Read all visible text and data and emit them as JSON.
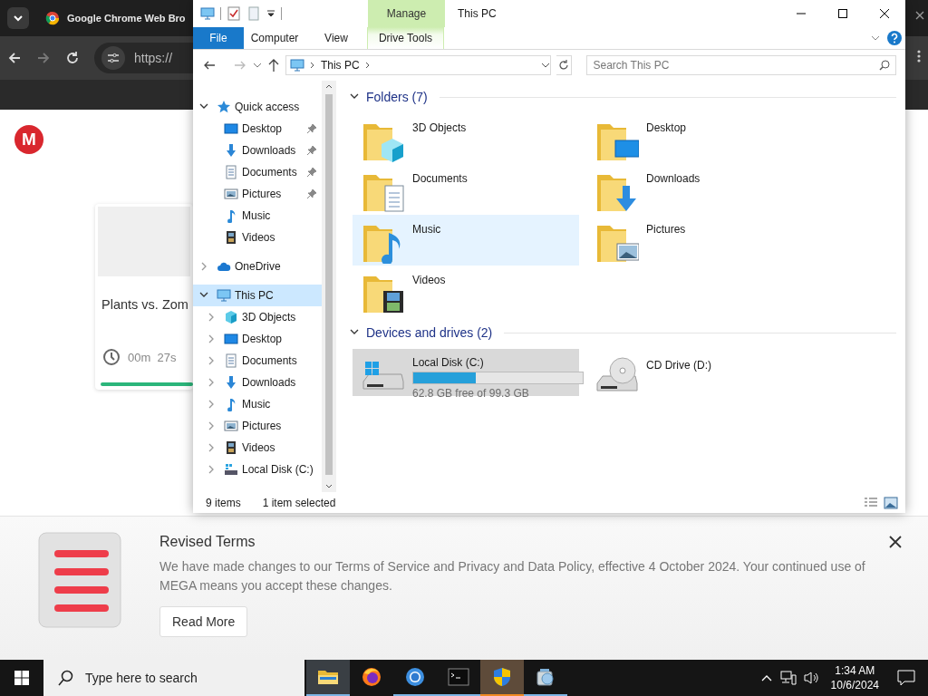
{
  "browser": {
    "tab_title": "Google Chrome Web Bro",
    "url": "https://"
  },
  "page": {
    "logo": "M",
    "card": {
      "title": "Plants vs. Zom",
      "timer": "00m  27s"
    }
  },
  "banner": {
    "title": "Revised Terms",
    "text": "We have made changes to our Terms of Service and Privacy and Data Policy, effective 4 October 2024. Your continued use of MEGA means you accept these changes.",
    "button": "Read More"
  },
  "explorer": {
    "context_tab": "Manage",
    "title": "This PC",
    "ribbon_tabs": [
      {
        "label": "File",
        "kind": "file"
      },
      {
        "label": "Computer",
        "kind": "tab"
      },
      {
        "label": "View",
        "kind": "tab"
      },
      {
        "label": "Drive Tools",
        "kind": "context"
      }
    ],
    "address": "This PC",
    "search": {
      "placeholder": "Search This PC"
    },
    "nav": [
      {
        "label": "Quick access",
        "kind": "star",
        "expanded": true,
        "selected": false,
        "children": [
          {
            "label": "Desktop",
            "kind": "desktop",
            "pinned": true,
            "selected": false
          },
          {
            "label": "Downloads",
            "kind": "downloads",
            "pinned": true,
            "selected": false
          },
          {
            "label": "Documents",
            "kind": "documents",
            "pinned": true,
            "selected": false
          },
          {
            "label": "Pictures",
            "kind": "pictures",
            "pinned": true,
            "selected": false
          },
          {
            "label": "Music",
            "kind": "music",
            "pinned": false,
            "selected": false
          },
          {
            "label": "Videos",
            "kind": "videos",
            "pinned": false,
            "selected": false
          }
        ]
      },
      {
        "label": "OneDrive",
        "kind": "cloud",
        "expanded": false,
        "selected": false
      },
      {
        "label": "This PC",
        "kind": "pc",
        "expanded": true,
        "selected": true,
        "children": [
          {
            "label": "3D Objects",
            "kind": "cube",
            "expanded": false,
            "selected": false
          },
          {
            "label": "Desktop",
            "kind": "desktop",
            "expanded": false,
            "selected": false
          },
          {
            "label": "Documents",
            "kind": "documents",
            "expanded": false,
            "selected": false
          },
          {
            "label": "Downloads",
            "kind": "downloads",
            "expanded": false,
            "selected": false
          },
          {
            "label": "Music",
            "kind": "music",
            "expanded": false,
            "selected": false
          },
          {
            "label": "Pictures",
            "kind": "pictures",
            "expanded": false,
            "selected": false
          },
          {
            "label": "Videos",
            "kind": "videos",
            "expanded": false,
            "selected": false
          },
          {
            "label": "Local Disk (C:)",
            "kind": "disk",
            "expanded": false,
            "selected": false
          }
        ]
      }
    ],
    "folders": {
      "heading": "Folders (7)",
      "expanded": true,
      "items": [
        {
          "name": "3D Objects",
          "kind": "cube",
          "selected": false,
          "hovered": false
        },
        {
          "name": "Desktop",
          "kind": "desktop",
          "selected": false,
          "hovered": false
        },
        {
          "name": "Documents",
          "kind": "documents",
          "selected": false,
          "hovered": false
        },
        {
          "name": "Downloads",
          "kind": "downloads",
          "selected": false,
          "hovered": false
        },
        {
          "name": "Music",
          "kind": "music",
          "selected": false,
          "hovered": true
        },
        {
          "name": "Pictures",
          "kind": "pictures",
          "selected": false,
          "hovered": false
        },
        {
          "name": "Videos",
          "kind": "videos",
          "selected": false,
          "hovered": false
        }
      ]
    },
    "drives": {
      "heading": "Devices and drives (2)",
      "expanded": true,
      "items": [
        {
          "name": "Local Disk (C:)",
          "kind": "hdd",
          "selected": true,
          "level": 0.37,
          "free": "62.8 GB free of 99.3 GB"
        },
        {
          "name": "CD Drive (D:)",
          "kind": "cd",
          "selected": false
        }
      ]
    },
    "status": {
      "count": "9 items",
      "selection": "1 item selected"
    }
  },
  "taskbar": {
    "search": {
      "placeholder": "Type here to search"
    },
    "apps": [
      {
        "kind": "explorer",
        "running": true,
        "focused": true,
        "flashing": false
      },
      {
        "kind": "firefox",
        "running": false,
        "focused": false,
        "flashing": false
      },
      {
        "kind": "chrome",
        "running": true,
        "focused": false,
        "flashing": false
      },
      {
        "kind": "terminal",
        "running": true,
        "focused": false,
        "flashing": false
      },
      {
        "kind": "shield",
        "running": true,
        "focused": false,
        "flashing": true
      },
      {
        "kind": "cleanup",
        "running": true,
        "focused": false,
        "flashing": false
      }
    ],
    "time": "1:34 AM",
    "date": "10/6/2024"
  }
}
